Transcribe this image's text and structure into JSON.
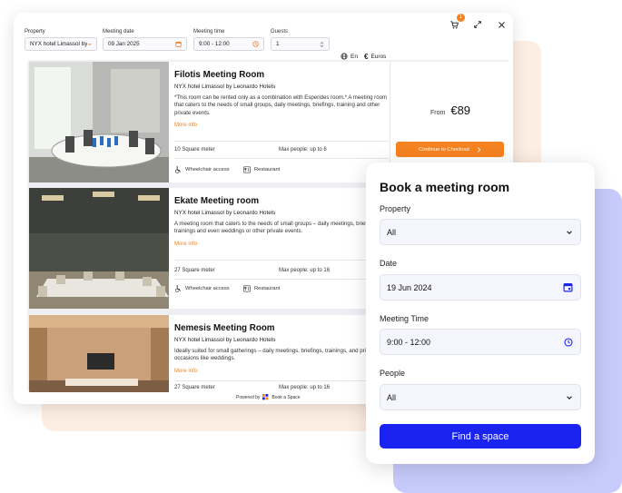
{
  "window": {
    "icons": [
      "cart-icon",
      "expand-icon",
      "close-icon"
    ],
    "cart_count": "1"
  },
  "filters": {
    "property": {
      "label": "Property",
      "value": "NYX hotel Limassol by L"
    },
    "date": {
      "label": "Meeting date",
      "value": "09 Jan 2025"
    },
    "time": {
      "label": "Meeting time",
      "value": "9:00 - 12:00"
    },
    "guests": {
      "label": "Guests",
      "value": "1"
    },
    "language": "En",
    "currency": "Euros"
  },
  "rooms": [
    {
      "title": "Filotis Meeting Room",
      "hotel": "NYX hotel Limassol by Leonardo Hotels",
      "description": "*This room can be rented only as a combination with Esperides room.* A meeting room that caters to the needs of small groups, daily meetings, briefings, training and other private events.",
      "more": "More info",
      "size": "10 Square meter",
      "max_people": "Max people: up to 6",
      "amenity_1": "Wheelchair access",
      "amenity_2": "Restaurant",
      "from_label": "From",
      "price": "€89",
      "checkout_label": "Continue to Checkout"
    },
    {
      "title": "Ekate Meeting room",
      "hotel": "NYX hotel Limassol by Leonardo Hotels",
      "description": "A meeting room that caters to the needs of small groups – daily meetings, briefings, trainings and even weddings or other private events.",
      "more": "More info",
      "size": "27 Square meter",
      "max_people": "Max people: up to 16",
      "amenity_1": "Wheelchair access",
      "amenity_2": "Restaurant"
    },
    {
      "title": "Nemesis Meeting Room",
      "hotel": "NYX hotel Limassol by Leonardo Hotels",
      "description": "Ideally suited for small gatherings – daily meetings, briefings, trainings, and private occasions like weddings.",
      "more": "More info",
      "size": "27 Square meter",
      "max_people": "Max people: up to 16"
    }
  ],
  "footer": {
    "powered_by": "Powered by",
    "brand": "Book a Space"
  },
  "booking": {
    "title": "Book a meeting room",
    "property_label": "Property",
    "property_value": "All",
    "date_label": "Date",
    "date_value": "19 Jun 2024",
    "time_label": "Meeting Time",
    "time_value": "9:00 - 12:00",
    "people_label": "People",
    "people_value": "All",
    "find_label": "Find a space"
  },
  "colors": {
    "accent": "#f58220",
    "primary": "#1b23f0",
    "peach": "#fdeee3",
    "lilac": "#c7cbfb"
  }
}
